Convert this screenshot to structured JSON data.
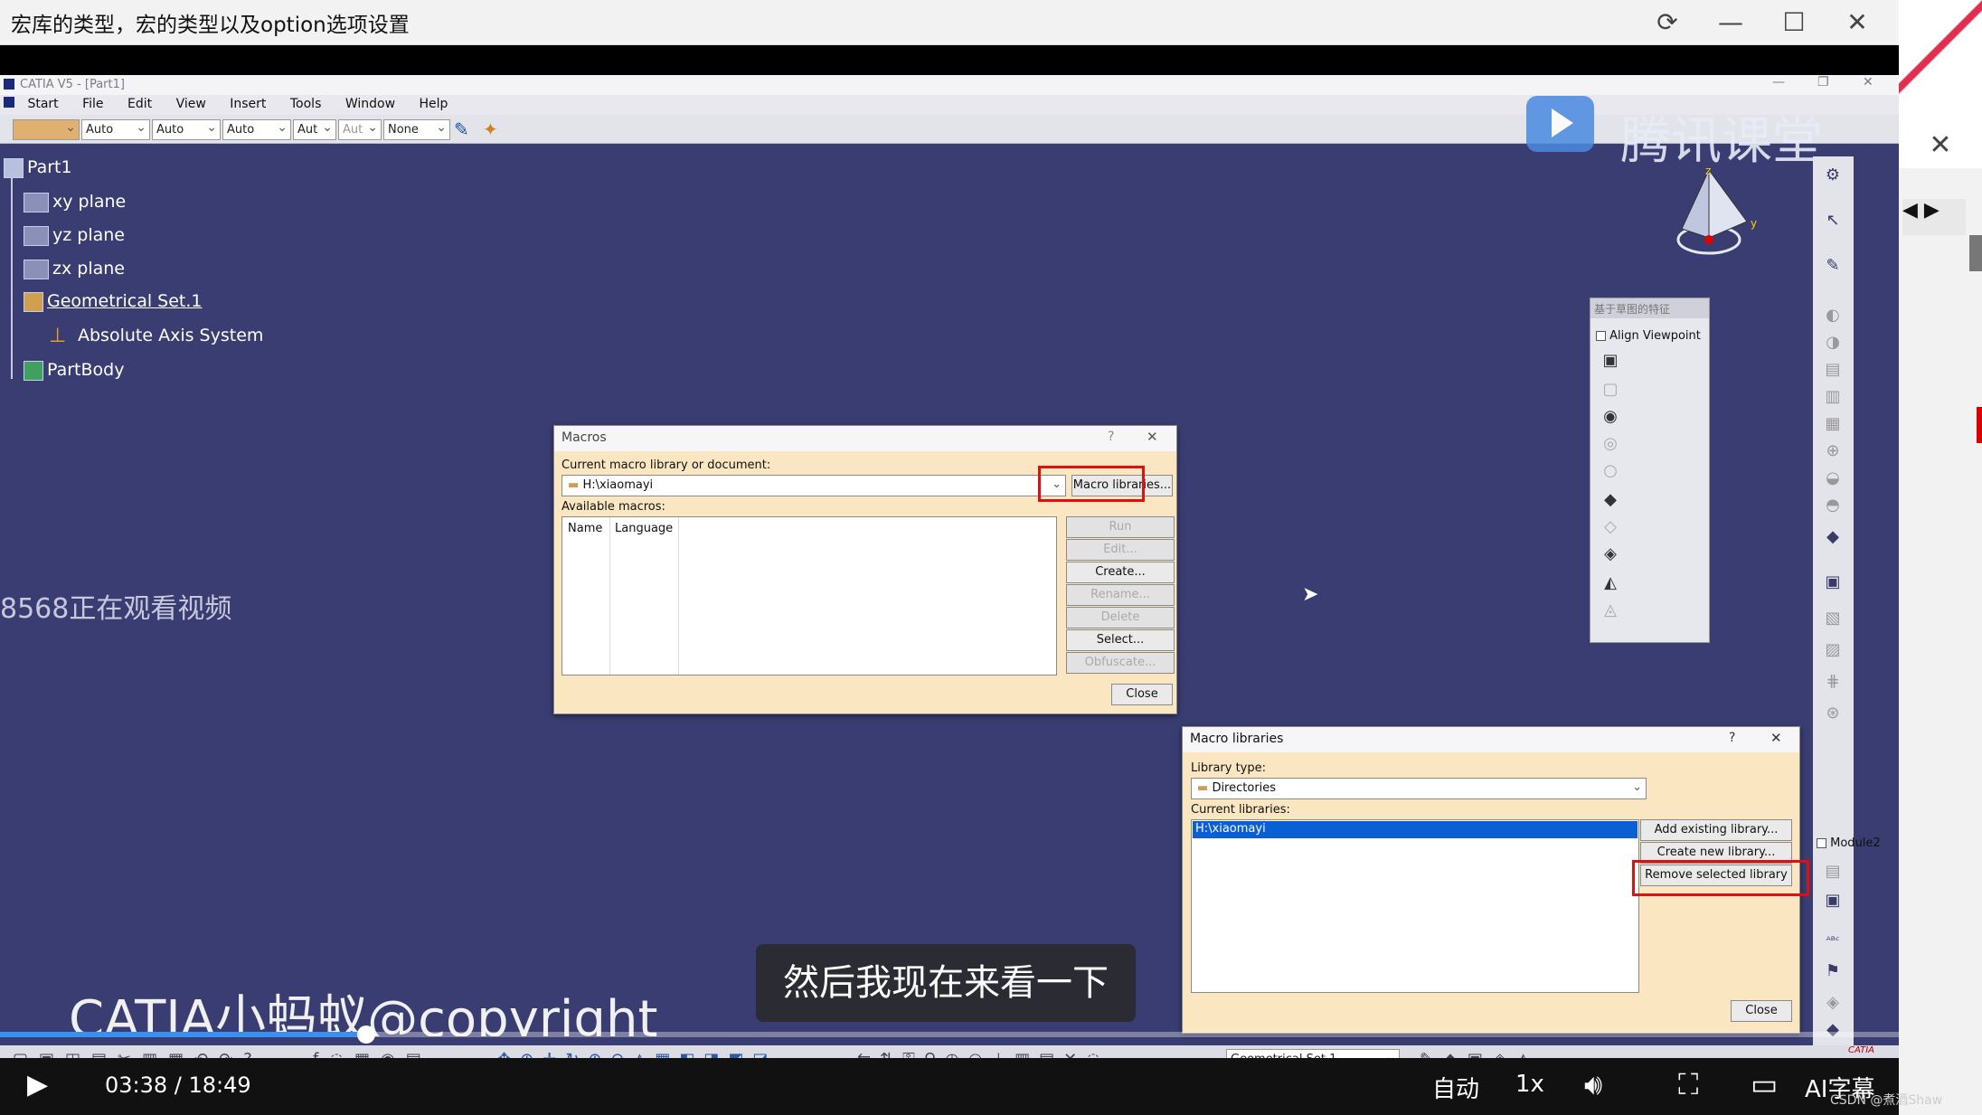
{
  "player": {
    "title": "宏库的类型，宏的类型以及option选项设置",
    "time": "03:38 / 18:49",
    "quality": "自动",
    "speed": "1x",
    "ai_subtitle": "AI字幕",
    "progress": 0.193,
    "subtitle": "然后我现在来看一下",
    "watching": "8568正在观看视频",
    "watermark": "CATIA小蚂蚁@copyright",
    "logo_text": "腾讯课堂",
    "credit": "CSDN @煮酒Shaw"
  },
  "catia": {
    "title": "CATIA V5 - [Part1]",
    "menu": [
      "Start",
      "File",
      "Edit",
      "View",
      "Insert",
      "Tools",
      "Window",
      "Help"
    ],
    "toolbar": {
      "dropdowns": [
        "Auto",
        "Auto",
        "Auto",
        "Aut",
        "Aut",
        "None"
      ]
    },
    "tree": {
      "root": "Part1",
      "items": [
        "xy plane",
        "yz plane",
        "zx plane",
        "Geometrical Set.1",
        "Absolute Axis System",
        "PartBody"
      ]
    },
    "compass": {
      "y": "y",
      "z": "z"
    },
    "palette": {
      "title": "基于草图的特征",
      "align": "Align Viewpoint"
    },
    "module_check": "Module2",
    "bottom_toolbar": {
      "set_dropdown": "Geometrical Set.1"
    }
  },
  "macros_dialog": {
    "title": "Macros",
    "help": "?",
    "current_label": "Current macro library or document:",
    "current_value": "H:\\xiaomayi",
    "macro_libraries_btn": "Macro libraries...",
    "available_label": "Available macros:",
    "columns": [
      "Name",
      "Language"
    ],
    "buttons": [
      "Run",
      "Edit...",
      "Create...",
      "Rename...",
      "Delete",
      "Select...",
      "Obfuscate..."
    ],
    "close": "Close"
  },
  "libraries_dialog": {
    "title": "Macro libraries",
    "help": "?",
    "type_label": "Library type:",
    "type_value": "Directories",
    "current_label": "Current libraries:",
    "libraries": [
      "H:\\xiaomayi"
    ],
    "add_btn": "Add existing library...",
    "create_btn": "Create new library...",
    "remove_btn": "Remove selected library",
    "close": "Close"
  },
  "colors": {
    "viewport": "#3a3d72",
    "dialog_bg": "#fbe6c2",
    "highlight": "#e01010",
    "selection": "#0a5fd4"
  }
}
